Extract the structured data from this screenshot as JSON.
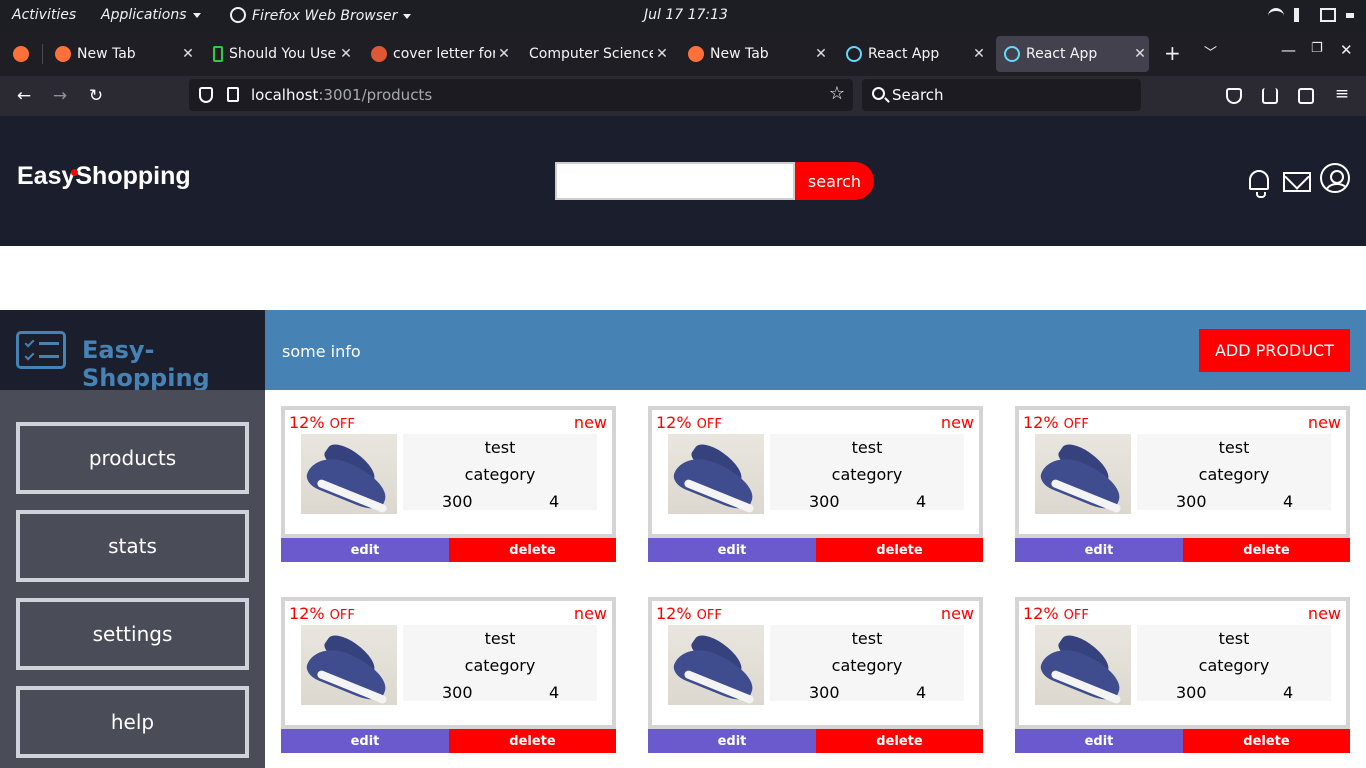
{
  "system_bar": {
    "activities": "Activities",
    "applications": "Applications",
    "browser": "Firefox Web Browser",
    "clock": "Jul 17  17:13"
  },
  "tabs": [
    {
      "title": "New Tab",
      "icon": "firefox-icon",
      "active": false
    },
    {
      "title": "Should You Use",
      "icon": "phone-icon",
      "active": false
    },
    {
      "title": "cover letter for",
      "icon": "duckduckgo-icon",
      "active": false
    },
    {
      "title": "Computer Science",
      "icon": "none",
      "active": false
    },
    {
      "title": "New Tab",
      "icon": "firefox-icon",
      "active": false
    },
    {
      "title": "React App",
      "icon": "react-icon",
      "active": false
    },
    {
      "title": "React App",
      "icon": "react-icon",
      "active": true
    }
  ],
  "navbar": {
    "url_host": "localhost",
    "url_rest": ":3001/products",
    "search_placeholder": "Search"
  },
  "header": {
    "logo": "EasyShopping",
    "search_button": "search",
    "search_value": ""
  },
  "sidebar": {
    "brand": "Easy-Shopping",
    "items": [
      "products",
      "stats",
      "settings",
      "help"
    ]
  },
  "infobar": {
    "text": "some info",
    "add_button": "ADD PRODUCT"
  },
  "products": [
    {
      "discount": "12%",
      "discount_suffix": "OFF",
      "badge": "new",
      "name": "test",
      "category": "category",
      "price": "300",
      "quantity": "4",
      "edit": "edit",
      "delete": "delete"
    },
    {
      "discount": "12%",
      "discount_suffix": "OFF",
      "badge": "new",
      "name": "test",
      "category": "category",
      "price": "300",
      "quantity": "4",
      "edit": "edit",
      "delete": "delete"
    },
    {
      "discount": "12%",
      "discount_suffix": "OFF",
      "badge": "new",
      "name": "test",
      "category": "category",
      "price": "300",
      "quantity": "4",
      "edit": "edit",
      "delete": "delete"
    },
    {
      "discount": "12%",
      "discount_suffix": "OFF",
      "badge": "new",
      "name": "test",
      "category": "category",
      "price": "300",
      "quantity": "4",
      "edit": "edit",
      "delete": "delete"
    },
    {
      "discount": "12%",
      "discount_suffix": "OFF",
      "badge": "new",
      "name": "test",
      "category": "category",
      "price": "300",
      "quantity": "4",
      "edit": "edit",
      "delete": "delete"
    },
    {
      "discount": "12%",
      "discount_suffix": "OFF",
      "badge": "new",
      "name": "test",
      "category": "category",
      "price": "300",
      "quantity": "4",
      "edit": "edit",
      "delete": "delete"
    }
  ],
  "colors": {
    "header_bg": "#1b1f2d",
    "accent_red": "#ff0000",
    "info_blue": "#4682b4",
    "edit_purple": "#6a5acd",
    "sidebar_bg": "#4a4c57"
  }
}
